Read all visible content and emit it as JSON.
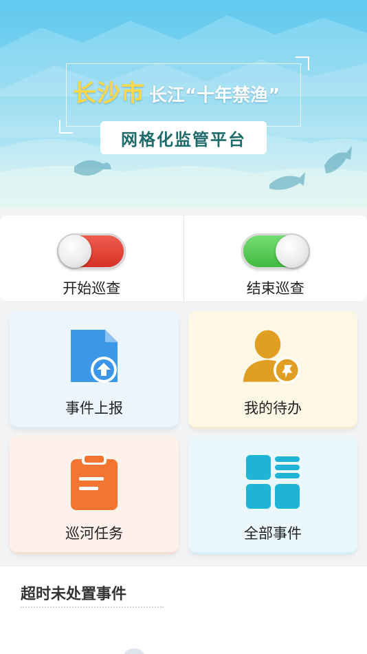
{
  "banner": {
    "city": "长沙市",
    "slogan": "长江“十年禁渔”",
    "subtitle": "网格化监管平台",
    "colors": {
      "city": "#ffd84a",
      "subtitle": "#1f6b6b",
      "sky_top": "#5fc9ef"
    }
  },
  "patrol": {
    "start": {
      "label": "开始巡查",
      "state": "off",
      "color": "#d52f24"
    },
    "end": {
      "label": "结束巡查",
      "state": "on",
      "color": "#3cb83b"
    }
  },
  "tiles": [
    {
      "label": "事件上报",
      "icon": "upload-document-icon",
      "color": "#3d97e8"
    },
    {
      "label": "我的待办",
      "icon": "user-pin-icon",
      "color": "#e09e22"
    },
    {
      "label": "巡河任务",
      "icon": "clipboard-icon",
      "color": "#f47531"
    },
    {
      "label": "全部事件",
      "icon": "grid-list-icon",
      "color": "#1fb4d6"
    }
  ],
  "overdue": {
    "title": "超时未处置事件"
  }
}
